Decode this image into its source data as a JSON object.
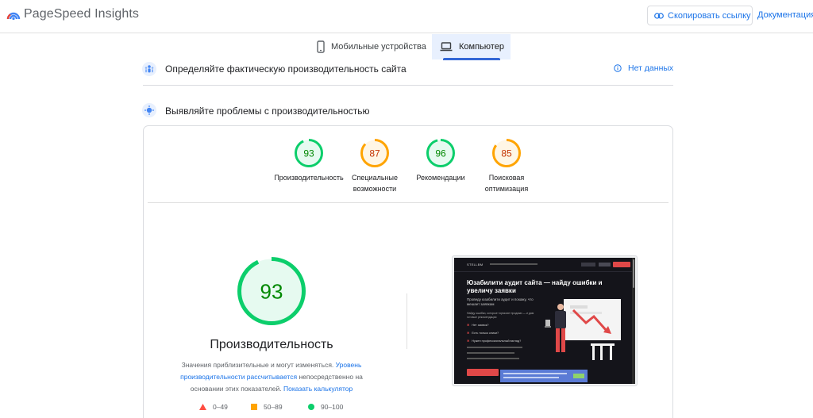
{
  "header": {
    "app_title": "PageSpeed Insights",
    "copy_link_label": "Скопировать ссылку",
    "docs_label": "Документация"
  },
  "tabs": [
    {
      "label": "Мобильные устройства",
      "icon": "smartphone-icon",
      "active": false
    },
    {
      "label": "Компьютер",
      "icon": "laptop-icon",
      "active": true
    }
  ],
  "field_section": {
    "title": "Определяйте фактическую производительность сайта",
    "status": "Нет данных"
  },
  "lab_section": {
    "title": "Выявляйте проблемы с производительностью"
  },
  "scores": [
    {
      "value": "93",
      "label": "Производительность",
      "color": "#0cce6b",
      "fraction": 0.93
    },
    {
      "value": "87",
      "label": "Специальные возможности",
      "color": "#ffa400",
      "fraction": 0.87
    },
    {
      "value": "96",
      "label": "Рекомендации",
      "color": "#0cce6b",
      "fraction": 0.96
    },
    {
      "value": "85",
      "label": "Поисковая оптимизация",
      "color": "#ffa400",
      "fraction": 0.85
    }
  ],
  "main_score": {
    "value": "93",
    "label": "Производительность",
    "fraction": 0.93,
    "color": "#0cce6b"
  },
  "description": {
    "part1": "Значения приблизительные и могут изменяться. ",
    "link1": "Уровень производительности рассчитывается",
    "part2": " непосредственно на основании этих показателей. ",
    "link2": "Показать калькулятор"
  },
  "legend": [
    {
      "range": "0–49",
      "color": "#ff4e42",
      "shape": "triangle"
    },
    {
      "range": "50–89",
      "color": "#ffa400",
      "shape": "square"
    },
    {
      "range": "90–100",
      "color": "#0cce6b",
      "shape": "circle"
    }
  ],
  "preview": {
    "logo": "STELLBM",
    "heading": "Юзабилити аудит сайта — найду ошибки и увеличу заявки",
    "sub": "Проведу юзабилити аудит и покажу, что мешает заявкам",
    "small": "Найду ошибки, которые тормозят продажи — и дам готовые рекомендации",
    "bullets": [
      "Нет заявок?",
      "Есть только клики?",
      "Нужен профессиональный взгляд?"
    ]
  },
  "colors": {
    "accent": "#1a73e8",
    "pass": "#0cce6b",
    "average": "#ffa400",
    "fail": "#ff4e42"
  }
}
